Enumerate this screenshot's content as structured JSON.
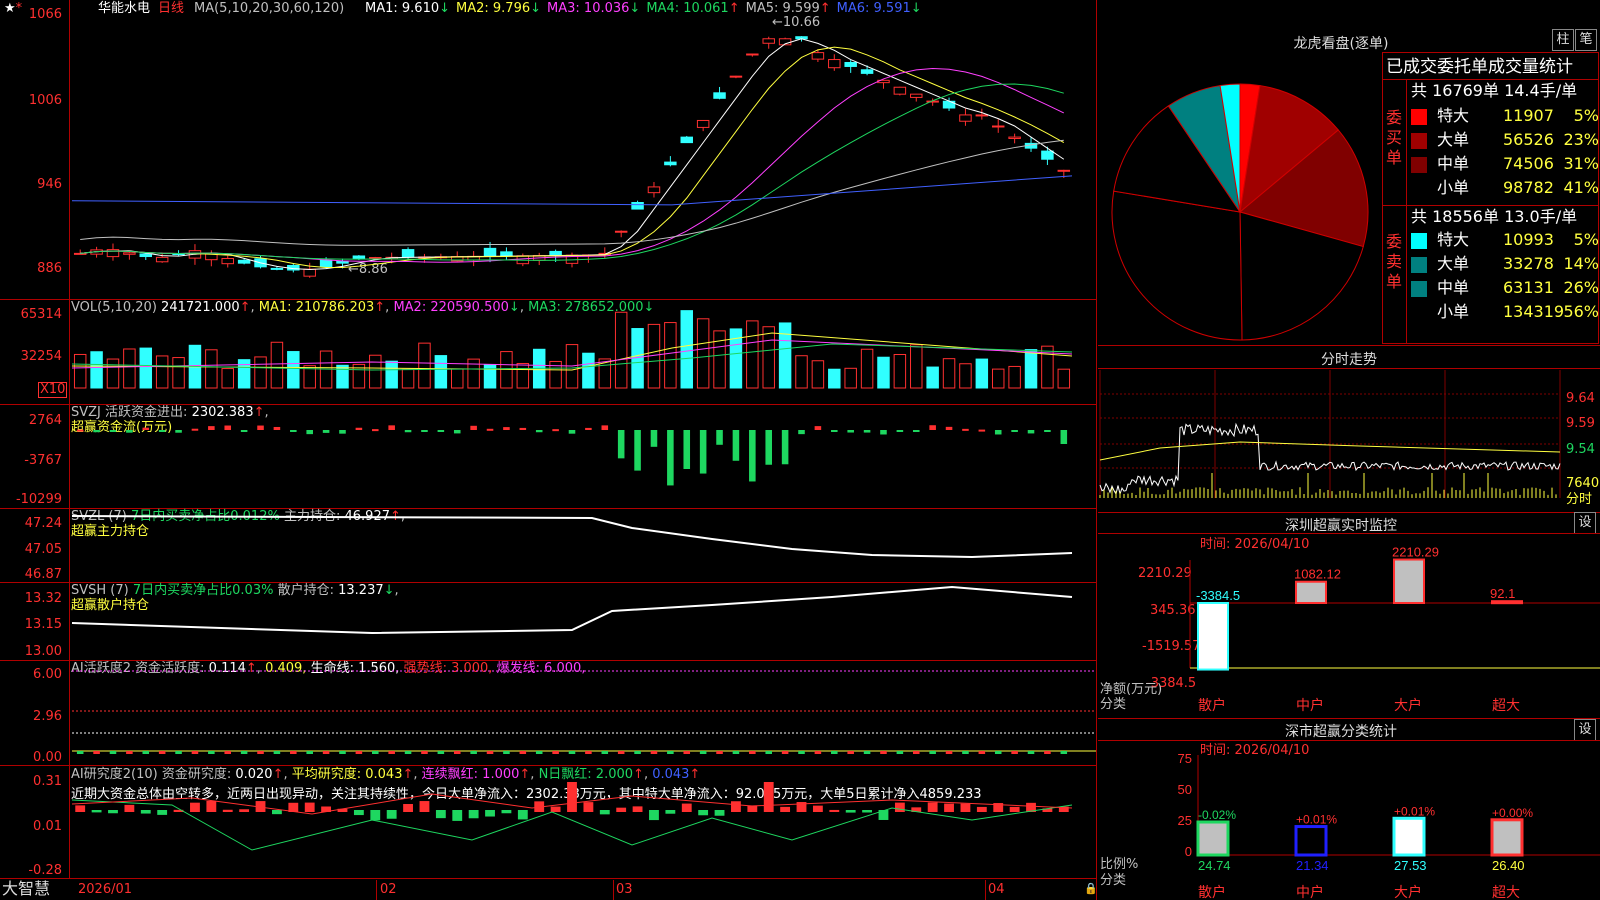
{
  "stock": {
    "name": "华能水电",
    "period": "日线"
  },
  "ma_legend": {
    "params": "MA(5,10,20,30,60,120)",
    "items": [
      {
        "label": "MA1:",
        "value": "9.610",
        "arrow": "↓",
        "color": "#ffffff"
      },
      {
        "label": "MA2:",
        "value": "9.796",
        "arrow": "↓",
        "color": "#ffff40"
      },
      {
        "label": "MA3:",
        "value": "10.036",
        "arrow": "↓",
        "color": "#ff40ff"
      },
      {
        "label": "MA4:",
        "value": "10.061",
        "arrow": "↑",
        "color": "#1ed760"
      },
      {
        "label": "MA5:",
        "value": "9.599",
        "arrow": "↑",
        "color": "#c0c0c0"
      },
      {
        "label": "MA6:",
        "value": "9.591",
        "arrow": "↓",
        "color": "#4060ff"
      }
    ]
  },
  "price_axis": [
    "1066",
    "1006",
    "946",
    "886"
  ],
  "price_markers": {
    "high": "10.66",
    "low": "8.86"
  },
  "vol": {
    "legend": "VOL(5,10,20)",
    "value": "241721.000",
    "arrow": "↑",
    "ma1": "MA1: 210786.203",
    "ma1_arrow": "↑",
    "ma2": "MA2: 220590.500",
    "ma2_arrow": "↓",
    "ma3": "MA3: 278652.000",
    "ma3_arrow": "↓",
    "axis": [
      "65314",
      "32254"
    ],
    "unit": "X10"
  },
  "svzj": {
    "code": "SVZJ",
    "desc": "活跃资金进出:",
    "value": "2302.383",
    "arrow": "↑",
    "sub": "超赢资金流(万元)",
    "axis": [
      "2764",
      "-3767",
      "-10299"
    ]
  },
  "svzl": {
    "code": "SVZL (7)",
    "desc": "7日内买卖净占比0.012%",
    "label": "主力持仓:",
    "value": "46.927",
    "arrow": "↑",
    "sub": "超赢主力持仓",
    "axis": [
      "47.24",
      "47.05",
      "46.87"
    ]
  },
  "svsh": {
    "code": "SVSH (7)",
    "desc": "7日内买卖净占比0.03%",
    "label": "散户持仓:",
    "value": "13.237",
    "arrow": "↓",
    "sub": "超赢散户持仓",
    "axis": [
      "13.32",
      "13.15",
      "13.00"
    ]
  },
  "ai1": {
    "title": "AI活跃度2",
    "label": "资金活跃度:",
    "v1": "0.114",
    "arrow": "↑",
    "v2": "0.409,",
    "life": "生命线: 1.560,",
    "strong": "强势线: 3.000,",
    "burst": "爆发线: 6.000,",
    "axis": [
      "6.00",
      "2.96",
      "0.00"
    ]
  },
  "ai2": {
    "title": "AI研究度2(10)",
    "label": "资金研究度:",
    "v1": "0.020",
    "arrow": "↑",
    "avg": "平均研究度: 0.043",
    "avg_arrow": "↑",
    "red": "连续飘红: 1.000",
    "red_arrow": "↑",
    "nred": "N日飘红: 2.000",
    "nred_arrow": "↑",
    "v5": "0.043",
    "v5_arrow": "↑",
    "comment": "近期大资金总体由空转多，近两日出现异动，关注其持续性，今日大单净流入：2302.38万元，其中特大单净流入：92.095万元，大单5日累计净入4859.233",
    "axis": [
      "0.31",
      "0.01",
      "-0.28"
    ]
  },
  "date_axis": [
    "2026/01",
    "02",
    "03",
    "04"
  ],
  "brand": "大智慧",
  "lhb": {
    "title": "龙虎看盘(逐单)",
    "btn1": "柱",
    "btn2": "笔",
    "header": "已成交委托单成交量统计",
    "buy": {
      "label": "委买单",
      "summary": "共 16769单 14.4手/单",
      "rows": [
        {
          "name": "特大",
          "vol": "11907",
          "pct": "5%",
          "color": "#ff0000"
        },
        {
          "name": "大单",
          "vol": "56526",
          "pct": "23%",
          "color": "#a00000"
        },
        {
          "name": "中单",
          "vol": "74506",
          "pct": "31%",
          "color": "#800000"
        },
        {
          "name": "小单",
          "vol": "98782",
          "pct": "41%",
          "color": "#000000"
        }
      ]
    },
    "sell": {
      "label": "委卖单",
      "summary": "共 18556单 13.0手/单",
      "rows": [
        {
          "name": "特大",
          "vol": "10993",
          "pct": "5%",
          "color": "#00ffff"
        },
        {
          "name": "大单",
          "vol": "33278",
          "pct": "14%",
          "color": "#008080"
        },
        {
          "name": "中单",
          "vol": "63131",
          "pct": "26%",
          "color": "#008080"
        },
        {
          "name": "小单",
          "vol": "134319",
          "pct": "56%",
          "color": "#000000"
        }
      ]
    }
  },
  "intraday": {
    "title": "分时走势",
    "axis": [
      "9.64",
      "9.59",
      "9.54"
    ],
    "vol": "7640",
    "unit": "分时"
  },
  "monitor": {
    "title": "深圳超赢实时监控",
    "btn": "设",
    "time": "时间: 2026/04/10",
    "axis": [
      "2210.29",
      "345.36",
      "-1519.57",
      "-3384.5"
    ],
    "unit": "净额(万元)",
    "cat_label": "分类",
    "cats": [
      "散户",
      "中户",
      "大户",
      "超大"
    ],
    "values": [
      -3384.5,
      1082.12,
      2210.29,
      92.1
    ],
    "labels": [
      "-3384.5",
      "1082.12",
      "2210.29",
      "92.1"
    ]
  },
  "classify": {
    "title": "深市超赢分类统计",
    "btn": "设",
    "time": "时间: 2026/04/10",
    "axis": [
      "75",
      "50",
      "25",
      "0"
    ],
    "unit": "比例%",
    "cat_label": "分类",
    "cats": [
      "散户",
      "中户",
      "大户",
      "超大"
    ],
    "values": [
      24.74,
      21.34,
      27.53,
      26.4
    ],
    "labels": [
      "24.74",
      "21.34",
      "27.53",
      "26.40"
    ],
    "changes": [
      "-0.02%",
      "+0.01%",
      "+0.01%",
      "+0.00%"
    ]
  }
}
